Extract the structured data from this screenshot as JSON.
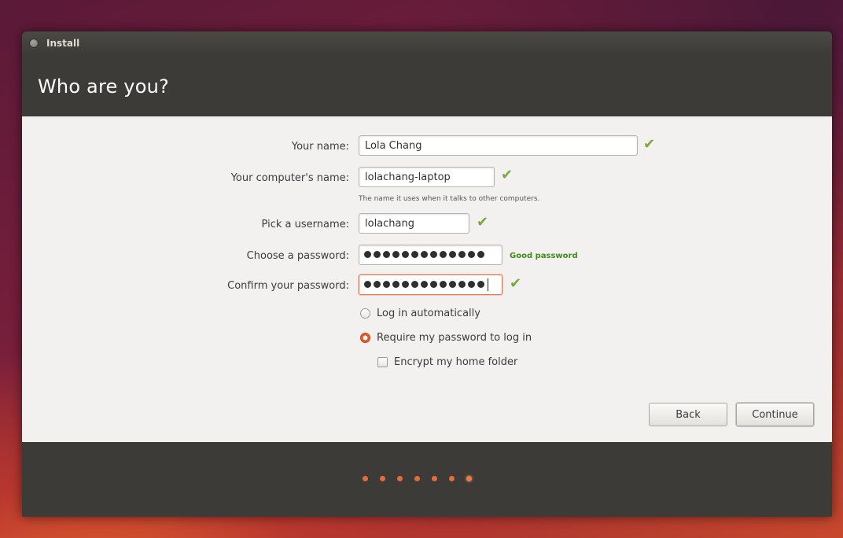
{
  "window": {
    "title": "Install",
    "heading": "Who are you?"
  },
  "form": {
    "name": {
      "label": "Your name:",
      "value": "Lola Chang",
      "valid": true
    },
    "computer_name": {
      "label": "Your computer's name:",
      "value": "lolachang-laptop",
      "hint": "The name it uses when it talks to other computers.",
      "valid": true
    },
    "username": {
      "label": "Pick a username:",
      "value": "lolachang",
      "valid": true
    },
    "password": {
      "label": "Choose a password:",
      "masked_length": 13,
      "strength": "Good password"
    },
    "confirm_password": {
      "label": "Confirm your password:",
      "masked_length": 13,
      "valid": true
    },
    "login_options": [
      {
        "label": "Log in automatically",
        "selected": false
      },
      {
        "label": "Require my password to log in",
        "selected": true
      }
    ],
    "encrypt_home": {
      "label": "Encrypt my home folder",
      "checked": false
    }
  },
  "buttons": {
    "back": "Back",
    "continue": "Continue"
  },
  "progress": {
    "total": 7,
    "current": 7
  },
  "colors": {
    "accent": "#e5582c",
    "check": "#7aa83f",
    "strength": "#3e8b17",
    "window_dark": "#3c3b37",
    "content_bg": "#f2f1f0"
  },
  "icons": {
    "valid": "check-icon",
    "close": "close-icon"
  }
}
